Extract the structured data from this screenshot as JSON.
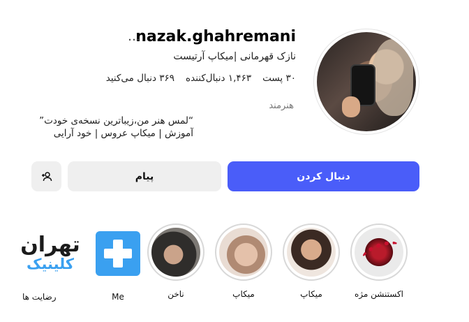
{
  "profile": {
    "username": "nazak.ghahremani",
    "more_icon": "…",
    "full_name": "نازک قهرمانی |میکاپ آرتیست",
    "stats": {
      "posts": "۳۰ پست",
      "followers": "۱,۴۶۳ دنبال‌کننده",
      "following": "۳۶۹ دنبال می‌کنید"
    },
    "category": "هنرمند",
    "bio_line1": "“لمس هنر من،زیباترین نسخه‌ی خودت”",
    "bio_line2": "آموزش | میکاپ عروس | خود آرایی"
  },
  "actions": {
    "follow_label": "دنبال کردن",
    "message_label": "پیام",
    "suggest_icon": "add-person-icon"
  },
  "highlights": [
    {
      "label": "اکستنشن مژه"
    },
    {
      "label": "میکاپ"
    },
    {
      "label": "میکاپ"
    },
    {
      "label": "ناخن"
    },
    {
      "label": "Me"
    },
    {
      "label": "رضایت ها"
    }
  ],
  "brand": {
    "top": "تهران",
    "bottom": "کلینیک"
  },
  "colors": {
    "accent": "#4a5df9",
    "secondary_button": "#efefef",
    "brand_blue": "#3aa0f0"
  }
}
